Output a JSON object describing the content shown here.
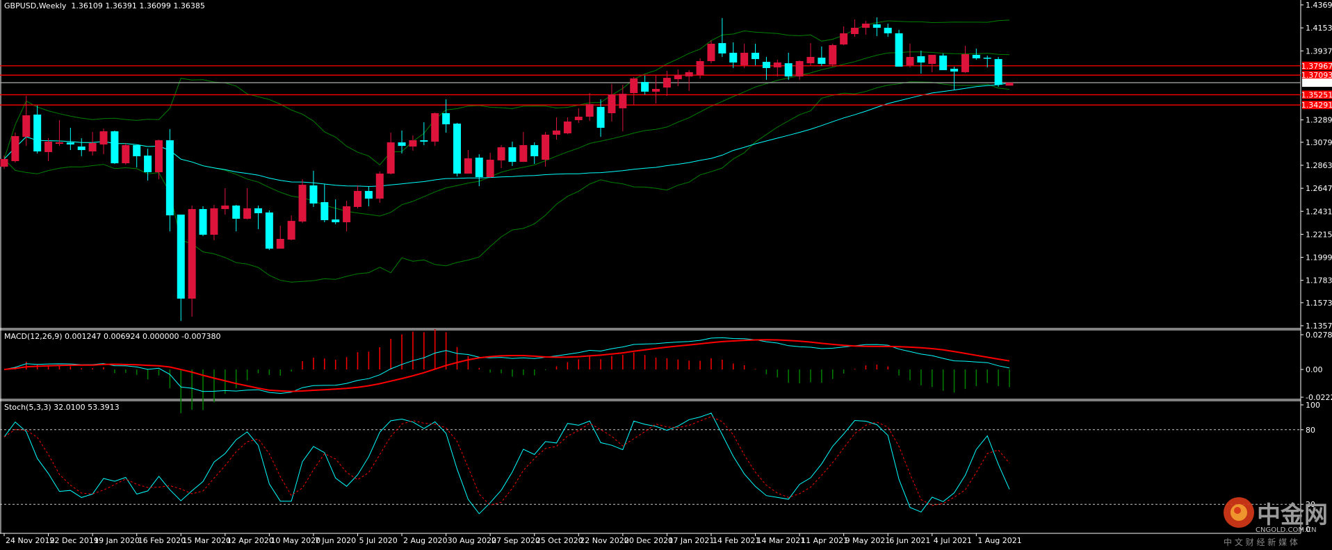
{
  "header": {
    "symbol": "GBPUSD,Weekly",
    "ohlc": "1.36109 1.36391 1.36099 1.36385"
  },
  "macd_label": "MACD(12,26,9) 0.001247 0.006924 0.000000 -0.007380",
  "stoch_label": "Stoch(5,3,3) 32.0100 53.3913",
  "logo": {
    "name": "中金网",
    "site": "CNGOLD.COM.CN",
    "slogan": "中 文 财 经 新 媒 体"
  },
  "colors": {
    "background": "#000000",
    "bull": "#DC143C",
    "bear": "#00FFFF",
    "bands": "#008000",
    "ma": "#00FFFF",
    "level": "#FF0000",
    "current": "#A0A0A0",
    "signal": "#FF0000",
    "hist_pos": "#FF0000",
    "hist_neg": "#008000"
  },
  "chart_data": [
    {
      "type": "candlestick",
      "title": "GBPUSD,Weekly",
      "ylim": [
        1.1357,
        1.4369
      ],
      "y_ticks": [
        "1.43690",
        "1.41530",
        "1.39370",
        "1.32890",
        "1.30790",
        "1.28630",
        "1.26470",
        "1.24310",
        "1.22150",
        "1.19990",
        "1.17830",
        "1.15730",
        "1.13570"
      ],
      "x_tick_labels": [
        {
          "index": 0,
          "label": "24 Nov 2019"
        },
        {
          "index": 4,
          "label": "22 Dec 2019"
        },
        {
          "index": 8,
          "label": "19 Jan 2020"
        },
        {
          "index": 12,
          "label": "16 Feb 2020"
        },
        {
          "index": 16,
          "label": "15 Mar 2020"
        },
        {
          "index": 20,
          "label": "12 Apr 2020"
        },
        {
          "index": 24,
          "label": "10 May 2020"
        },
        {
          "index": 28,
          "label": "7 Jun 2020"
        },
        {
          "index": 32,
          "label": "5 Jul 2020"
        },
        {
          "index": 36,
          "label": "2 Aug 2020"
        },
        {
          "index": 40,
          "label": "30 Aug 2020"
        },
        {
          "index": 44,
          "label": "27 Sep 2020"
        },
        {
          "index": 48,
          "label": "25 Oct 2020"
        },
        {
          "index": 52,
          "label": "22 Nov 2020"
        },
        {
          "index": 56,
          "label": "20 Dec 2020"
        },
        {
          "index": 60,
          "label": "17 Jan 2021"
        },
        {
          "index": 64,
          "label": "14 Feb 2021"
        },
        {
          "index": 68,
          "label": "14 Mar 2021"
        },
        {
          "index": 72,
          "label": "11 Apr 2021"
        },
        {
          "index": 76,
          "label": "9 May 2021"
        },
        {
          "index": 80,
          "label": "6 Jun 2021"
        },
        {
          "index": 84,
          "label": "4 Jul 2021"
        },
        {
          "index": 88,
          "label": "1 Aug 2021"
        }
      ],
      "levels": [
        {
          "price": 1.37967,
          "label": "1.37967",
          "kind": "resistance"
        },
        {
          "price": 1.37093,
          "label": "1.37093",
          "kind": "resistance"
        },
        {
          "price": 1.36385,
          "label": "1.36385",
          "kind": "current"
        },
        {
          "price": 1.35251,
          "label": "1.35251",
          "kind": "support"
        },
        {
          "price": 1.34291,
          "label": "1.34291",
          "kind": "support"
        }
      ],
      "indicators": [
        "Bollinger Bands",
        "Moving Average"
      ],
      "ohlc": [
        [
          1.285,
          1.2954,
          1.283,
          1.2922
        ],
        [
          1.2902,
          1.3169,
          1.2889,
          1.3137
        ],
        [
          1.313,
          1.3515,
          1.3045,
          1.3332
        ],
        [
          1.3339,
          1.3424,
          1.2974,
          1.2993
        ],
        [
          1.2987,
          1.3117,
          1.2902,
          1.3085
        ],
        [
          1.3065,
          1.3287,
          1.3045,
          1.3078
        ],
        [
          1.3078,
          1.3215,
          1.3006,
          1.3058
        ],
        [
          1.3039,
          1.3117,
          1.2948,
          1.3006
        ],
        [
          1.2993,
          1.3176,
          1.2954,
          1.3072
        ],
        [
          1.3058,
          1.3208,
          1.2967,
          1.3182
        ],
        [
          1.3182,
          1.3189,
          1.2876,
          1.2882
        ],
        [
          1.2882,
          1.3072,
          1.2869,
          1.3052
        ],
        [
          1.3052,
          1.3052,
          1.2843,
          1.2948
        ],
        [
          1.2954,
          1.3019,
          1.2719,
          1.2798
        ],
        [
          1.2798,
          1.3104,
          1.2732,
          1.3098
        ],
        [
          1.3098,
          1.3202,
          1.2243,
          1.2393
        ],
        [
          1.24,
          1.24,
          1.1402,
          1.1611
        ],
        [
          1.1611,
          1.2485,
          1.1442,
          1.2452
        ],
        [
          1.2452,
          1.2478,
          1.2198,
          1.2211
        ],
        [
          1.2211,
          1.2491,
          1.2159,
          1.2459
        ],
        [
          1.2452,
          1.2648,
          1.24,
          1.2485
        ],
        [
          1.2485,
          1.2491,
          1.2243,
          1.2361
        ],
        [
          1.2361,
          1.2648,
          1.2354,
          1.2459
        ],
        [
          1.2459,
          1.2485,
          1.2263,
          1.2413
        ],
        [
          1.242,
          1.2439,
          1.2067,
          1.208
        ],
        [
          1.208,
          1.2296,
          1.208,
          1.2172
        ],
        [
          1.2165,
          1.2393,
          1.2159,
          1.2341
        ],
        [
          1.2335,
          1.2732,
          1.2322,
          1.268
        ],
        [
          1.2674,
          1.2811,
          1.2472,
          1.2504
        ],
        [
          1.2517,
          1.2687,
          1.2328,
          1.2348
        ],
        [
          1.2354,
          1.2543,
          1.2309,
          1.2328
        ],
        [
          1.2328,
          1.253,
          1.2243,
          1.2478
        ],
        [
          1.2472,
          1.2674,
          1.2459,
          1.2622
        ],
        [
          1.2622,
          1.2667,
          1.2478,
          1.255
        ],
        [
          1.255,
          1.2804,
          1.2511,
          1.2785
        ],
        [
          1.2785,
          1.3169,
          1.2778,
          1.3078
        ],
        [
          1.3078,
          1.3189,
          1.2974,
          1.3045
        ],
        [
          1.3039,
          1.3143,
          1.3,
          1.3098
        ],
        [
          1.3098,
          1.3267,
          1.3052,
          1.3085
        ],
        [
          1.3085,
          1.3358,
          1.3045,
          1.3352
        ],
        [
          1.3352,
          1.3482,
          1.3169,
          1.3248
        ],
        [
          1.3254,
          1.3261,
          1.2759,
          1.2785
        ],
        [
          1.2785,
          1.3006,
          1.2785,
          1.2928
        ],
        [
          1.2935,
          1.2967,
          1.2667,
          1.2752
        ],
        [
          1.2752,
          1.298,
          1.2746,
          1.2915
        ],
        [
          1.2909,
          1.3052,
          1.2837,
          1.3032
        ],
        [
          1.3032,
          1.3085,
          1.2856,
          1.2895
        ],
        [
          1.2895,
          1.3176,
          1.2895,
          1.3052
        ],
        [
          1.3052,
          1.3078,
          1.2876,
          1.2948
        ],
        [
          1.2915,
          1.3176,
          1.285,
          1.315
        ],
        [
          1.315,
          1.3313,
          1.3104,
          1.3189
        ],
        [
          1.3163,
          1.3313,
          1.3156,
          1.3274
        ],
        [
          1.3287,
          1.3398,
          1.3261,
          1.3319
        ],
        [
          1.3319,
          1.3541,
          1.328,
          1.3437
        ],
        [
          1.3411,
          1.3482,
          1.313,
          1.3215
        ],
        [
          1.3352,
          1.3626,
          1.3274,
          1.3528
        ],
        [
          1.3398,
          1.3619,
          1.3182,
          1.3534
        ],
        [
          1.3541,
          1.3691,
          1.343,
          1.3678
        ],
        [
          1.3645,
          1.3704,
          1.3528,
          1.3554
        ],
        [
          1.3554,
          1.3704,
          1.3443,
          1.358
        ],
        [
          1.3593,
          1.375,
          1.3515,
          1.3684
        ],
        [
          1.3671,
          1.3763,
          1.3606,
          1.371
        ],
        [
          1.3697,
          1.3756,
          1.3561,
          1.3737
        ],
        [
          1.371,
          1.3867,
          1.3678,
          1.3841
        ],
        [
          1.3841,
          1.4036,
          1.3821,
          1.4004
        ],
        [
          1.401,
          1.4245,
          1.388,
          1.3913
        ],
        [
          1.3919,
          1.4017,
          1.3776,
          1.3828
        ],
        [
          1.3802,
          1.4004,
          1.3776,
          1.3919
        ],
        [
          1.3919,
          1.4004,
          1.3802,
          1.386
        ],
        [
          1.3834,
          1.388,
          1.3665,
          1.3776
        ],
        [
          1.3782,
          1.3854,
          1.3697,
          1.3828
        ],
        [
          1.3821,
          1.3919,
          1.3665,
          1.3697
        ],
        [
          1.3697,
          1.3847,
          1.3665,
          1.3841
        ],
        [
          1.3821,
          1.401,
          1.3802,
          1.388
        ],
        [
          1.3873,
          1.3978,
          1.3795,
          1.3815
        ],
        [
          1.3808,
          1.4004,
          1.3789,
          1.3991
        ],
        [
          1.3997,
          1.4167,
          1.3991,
          1.4102
        ],
        [
          1.4095,
          1.4232,
          1.4069,
          1.4154
        ],
        [
          1.4154,
          1.4219,
          1.4089,
          1.4193
        ],
        [
          1.4186,
          1.4252,
          1.4076,
          1.4154
        ],
        [
          1.4154,
          1.4193,
          1.4069,
          1.4102
        ],
        [
          1.4102,
          1.4134,
          1.3789,
          1.3789
        ],
        [
          1.3802,
          1.4004,
          1.3782,
          1.388
        ],
        [
          1.3887,
          1.3939,
          1.3724,
          1.3828
        ],
        [
          1.3815,
          1.39,
          1.3737,
          1.39
        ],
        [
          1.3893,
          1.3913,
          1.3756,
          1.3756
        ],
        [
          1.3769,
          1.3789,
          1.3567,
          1.3743
        ],
        [
          1.3737,
          1.3984,
          1.373,
          1.3906
        ],
        [
          1.39,
          1.3958,
          1.3854,
          1.3867
        ],
        [
          1.3873,
          1.3893,
          1.3782,
          1.3867
        ],
        [
          1.386,
          1.388,
          1.36,
          1.3619
        ],
        [
          1.36109,
          1.36391,
          1.36099,
          1.36385
        ]
      ]
    },
    {
      "type": "line",
      "title": "MACD(12,26,9)",
      "ylim": [
        -0.022201,
        0.027803
      ],
      "y_ticks": [
        "0.027803",
        "0.00",
        "-0.022201"
      ],
      "params": [
        12,
        26,
        9
      ],
      "last_values": [
        0.001247,
        0.006924,
        0.0,
        -0.00738
      ]
    },
    {
      "type": "line",
      "title": "Stoch(5,3,3)",
      "ylim": [
        0,
        100
      ],
      "y_ticks": [
        "100",
        "80",
        "20",
        "0"
      ],
      "levels": [
        20,
        80
      ],
      "params": [
        5,
        3,
        3
      ],
      "last_values": [
        32.01,
        53.3913
      ]
    }
  ]
}
